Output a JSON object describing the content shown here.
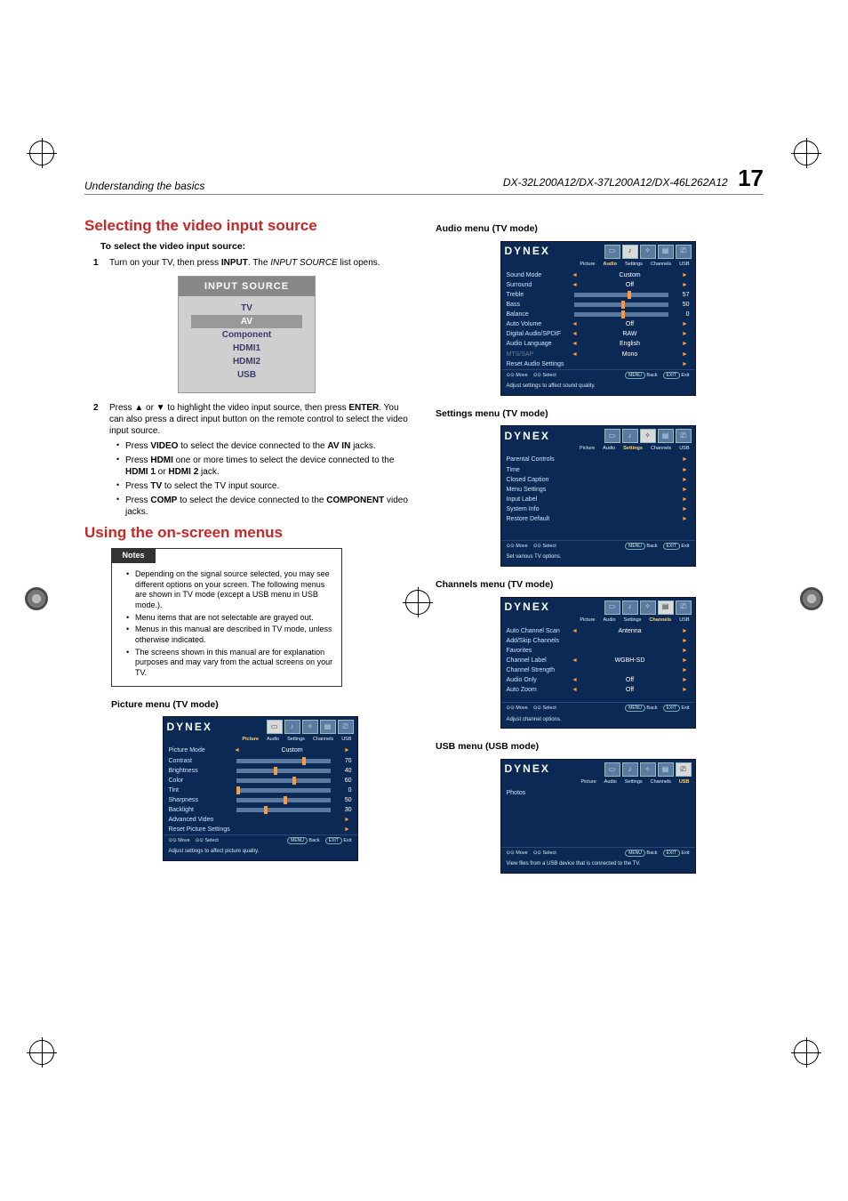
{
  "header": {
    "left": "Understanding the basics",
    "right": "DX-32L200A12/DX-37L200A12/DX-46L262A12",
    "page": "17"
  },
  "sectA": {
    "title": "Selecting the video input source",
    "sub": "To select the video input source:"
  },
  "step1_a": "Turn on your TV, then press ",
  "step1_b": "INPUT",
  "step1_c": ". The ",
  "step1_d": "INPUT SOURCE",
  "step1_e": " list opens.",
  "inputbox": {
    "title": "INPUT SOURCE",
    "items": [
      "TV",
      "AV",
      "Component",
      "HDMI1",
      "HDMI2",
      "USB"
    ],
    "selected": "AV"
  },
  "step2_a": "Press ▲ or ▼ to highlight the video input source, then press ",
  "step2_b": "ENTER",
  "step2_c": ". You can also press a direct input button on the remote control to select the video input source.",
  "b_video_a": "Press ",
  "b_video_b": "VIDEO",
  "b_video_c": " to select the device connected to the ",
  "b_video_d": "AV IN",
  "b_video_e": " jacks.",
  "b_hdmi_a": "Press ",
  "b_hdmi_b": "HDMI",
  "b_hdmi_c": " one or more times to select the device connected to the ",
  "b_hdmi_d": "HDMI 1",
  "b_hdmi_e": " or ",
  "b_hdmi_f": "HDMI 2",
  "b_hdmi_g": " jack.",
  "b_tv_a": "Press ",
  "b_tv_b": "TV",
  "b_tv_c": " to select the TV input source.",
  "b_comp_a": "Press ",
  "b_comp_b": "COMP",
  "b_comp_c": " to select the device connected to the ",
  "b_comp_d": "COMPONENT",
  "b_comp_e": " video jacks.",
  "sectB": {
    "title": "Using the on-screen menus"
  },
  "noteshdr": "Notes",
  "note1": "Depending on the signal source selected, you may see different options on your screen. The following menus are shown in TV mode (except a USB menu in USB mode.).",
  "note2": "Menu items that are not selectable are grayed out.",
  "note3": "Menus in this manual are described in TV mode, unless otherwise indicated.",
  "note4": "The screens shown in this manual are for explanation purposes and may vary from the actual screens on your TV.",
  "tabs": {
    "picture": "Picture",
    "audio": "Audio",
    "settings": "Settings",
    "channels": "Channels",
    "usb": "USB"
  },
  "brand": "DYNEX",
  "foot": {
    "move": "Move",
    "select": "Select",
    "back": "Back",
    "exit": "Exit",
    "menu": "MENU",
    "exitbtn": "EXIT"
  },
  "picture": {
    "caption": "Picture menu (TV mode)",
    "hint": "Adjust settings to affect picture quality.",
    "rows": [
      {
        "label": "Picture Mode",
        "val": "Custom",
        "arrows": true
      },
      {
        "label": "Contrast",
        "slider": 70,
        "num": "70"
      },
      {
        "label": "Brightness",
        "slider": 40,
        "num": "40"
      },
      {
        "label": "Color",
        "slider": 60,
        "num": "60"
      },
      {
        "label": "Tint",
        "slider": 0,
        "num": "0"
      },
      {
        "label": "Sharpness",
        "slider": 50,
        "num": "50"
      },
      {
        "label": "Backlight",
        "slider": 30,
        "num": "30"
      },
      {
        "label": "Advanced Video",
        "arrow_only": true
      },
      {
        "label": "Reset Picture Settings",
        "arrow_only": true
      }
    ]
  },
  "audio": {
    "caption": "Audio menu (TV mode)",
    "hint": "Adjust settings to affect sound quality.",
    "rows": [
      {
        "label": "Sound Mode",
        "val": "Custom",
        "arrows": true
      },
      {
        "label": "Surround",
        "val": "Off",
        "arrows": true
      },
      {
        "label": "Treble",
        "slider": 57,
        "num": "57"
      },
      {
        "label": "Bass",
        "slider": 50,
        "num": "50"
      },
      {
        "label": "Balance",
        "slider": 50,
        "num": "0"
      },
      {
        "label": "Auto Volume",
        "val": "Off",
        "arrows": true
      },
      {
        "label": "Digital Audio/SPDIF",
        "val": "RAW",
        "arrows": true
      },
      {
        "label": "Audio Language",
        "val": "English",
        "arrows": true
      },
      {
        "label": "MTS/SAP",
        "val": "Mono",
        "arrows": true,
        "dim": true
      },
      {
        "label": "Reset Audio Settings",
        "arrow_only": true
      }
    ]
  },
  "settings": {
    "caption": "Settings menu (TV mode)",
    "hint": "Set various TV options.",
    "rows": [
      {
        "label": "Parental Controls",
        "arrow_only": true
      },
      {
        "label": "Time",
        "arrow_only": true
      },
      {
        "label": "Closed Caption",
        "arrow_only": true
      },
      {
        "label": "Menu Settings",
        "arrow_only": true
      },
      {
        "label": "Input Label",
        "arrow_only": true
      },
      {
        "label": "System Info",
        "arrow_only": true
      },
      {
        "label": "Restore Default",
        "arrow_only": true
      }
    ]
  },
  "channels": {
    "caption": "Channels menu (TV mode)",
    "hint": "Adjust channel options.",
    "rows": [
      {
        "label": "Auto Channel Scan",
        "val": "Antenna",
        "arrows": true
      },
      {
        "label": "Add/Skip Channels",
        "arrow_only": true
      },
      {
        "label": "Favorites",
        "arrow_only": true
      },
      {
        "label": "Channel Label",
        "val": "WGBH-SD",
        "arrows": true
      },
      {
        "label": "Channel Strength",
        "arrow_only": true
      },
      {
        "label": "Audio Only",
        "val": "Off",
        "arrows": true
      },
      {
        "label": "Auto Zoom",
        "val": "Off",
        "arrows": true
      }
    ]
  },
  "usb": {
    "caption": "USB menu (USB mode)",
    "hint": "View files from a USB device that is connected to the TV.",
    "rows": [
      {
        "label": "Photos"
      }
    ]
  }
}
